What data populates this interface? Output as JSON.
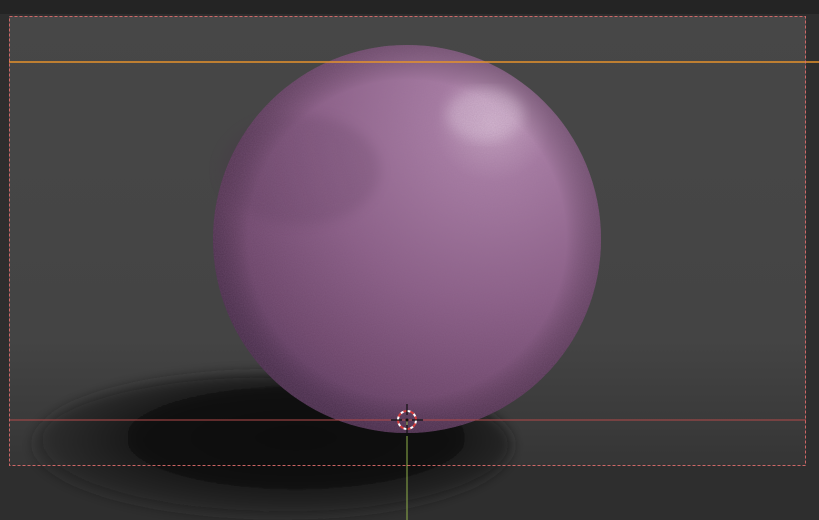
{
  "viewport": {
    "mode": "rendered-camera-view",
    "icons": [
      "3d-cursor-icon"
    ],
    "colors": {
      "outer_background": "#2e2e2e",
      "frame_background": "#474747",
      "camera_border": "#e06b6b",
      "orange_guide": "#e6922c",
      "red_guide": "#b34a4a",
      "y_axis_line": "#8fb04a",
      "sphere_base": "#9a6a95",
      "sphere_shadow_side": "#4f3550",
      "sphere_highlight": "#c7a6c2",
      "floor_shadow": "#121212"
    }
  }
}
